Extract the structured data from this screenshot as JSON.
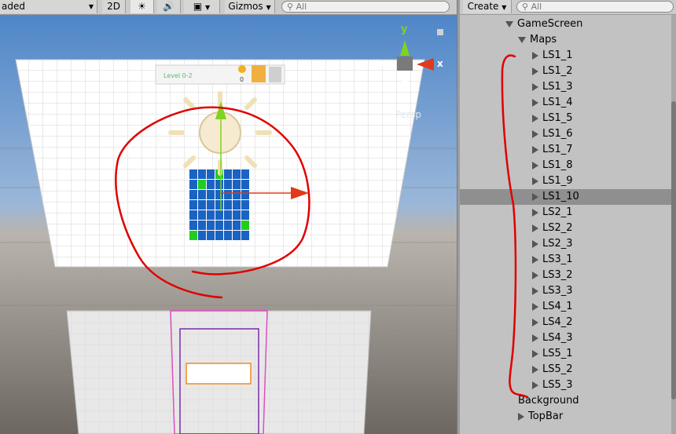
{
  "scene_toolbar": {
    "shading_mode": "aded",
    "mode_2d": "2D",
    "gizmos_label": "Gizmos",
    "search_placeholder": "All"
  },
  "game_ui": {
    "level_text": "Level 0-2",
    "coin_count": "0"
  },
  "gizmo": {
    "y_label": "y",
    "x_label": "x",
    "persp_label": "Persp"
  },
  "hierarchy": {
    "create_label": "Create",
    "search_placeholder": "All",
    "items": [
      {
        "label": "GameScreen",
        "indent": 0,
        "expand": "down",
        "selected": false
      },
      {
        "label": "Maps",
        "indent": 1,
        "expand": "down",
        "selected": false
      },
      {
        "label": "LS1_1",
        "indent": 2,
        "expand": "right",
        "selected": false
      },
      {
        "label": "LS1_2",
        "indent": 2,
        "expand": "right",
        "selected": false
      },
      {
        "label": "LS1_3",
        "indent": 2,
        "expand": "right",
        "selected": false
      },
      {
        "label": "LS1_4",
        "indent": 2,
        "expand": "right",
        "selected": false
      },
      {
        "label": "LS1_5",
        "indent": 2,
        "expand": "right",
        "selected": false
      },
      {
        "label": "LS1_6",
        "indent": 2,
        "expand": "right",
        "selected": false
      },
      {
        "label": "LS1_7",
        "indent": 2,
        "expand": "right",
        "selected": false
      },
      {
        "label": "LS1_8",
        "indent": 2,
        "expand": "right",
        "selected": false
      },
      {
        "label": "LS1_9",
        "indent": 2,
        "expand": "right",
        "selected": false
      },
      {
        "label": "LS1_10",
        "indent": 2,
        "expand": "right",
        "selected": true
      },
      {
        "label": "LS2_1",
        "indent": 2,
        "expand": "right",
        "selected": false
      },
      {
        "label": "LS2_2",
        "indent": 2,
        "expand": "right",
        "selected": false
      },
      {
        "label": "LS2_3",
        "indent": 2,
        "expand": "right",
        "selected": false
      },
      {
        "label": "LS3_1",
        "indent": 2,
        "expand": "right",
        "selected": false
      },
      {
        "label": "LS3_2",
        "indent": 2,
        "expand": "right",
        "selected": false
      },
      {
        "label": "LS3_3",
        "indent": 2,
        "expand": "right",
        "selected": false
      },
      {
        "label": "LS4_1",
        "indent": 2,
        "expand": "right",
        "selected": false
      },
      {
        "label": "LS4_2",
        "indent": 2,
        "expand": "right",
        "selected": false
      },
      {
        "label": "LS4_3",
        "indent": 2,
        "expand": "right",
        "selected": false
      },
      {
        "label": "LS5_1",
        "indent": 2,
        "expand": "right",
        "selected": false
      },
      {
        "label": "LS5_2",
        "indent": 2,
        "expand": "right",
        "selected": false
      },
      {
        "label": "LS5_3",
        "indent": 2,
        "expand": "right",
        "selected": false
      },
      {
        "label": "Background",
        "indent": 1,
        "expand": "none",
        "selected": false
      },
      {
        "label": "TopBar",
        "indent": 1,
        "expand": "right",
        "selected": false
      }
    ]
  },
  "colors": {
    "annotation_red": "#e00000",
    "grid_tile_blue": "#1a63c2",
    "grid_tile_green": "#22cc22",
    "gizmo_x_red": "#e03a1a",
    "gizmo_y_green": "#7ed321",
    "selection_pink": "#e04cc0",
    "selection_purple": "#7a2aa8",
    "selection_orange": "#f08a20"
  }
}
